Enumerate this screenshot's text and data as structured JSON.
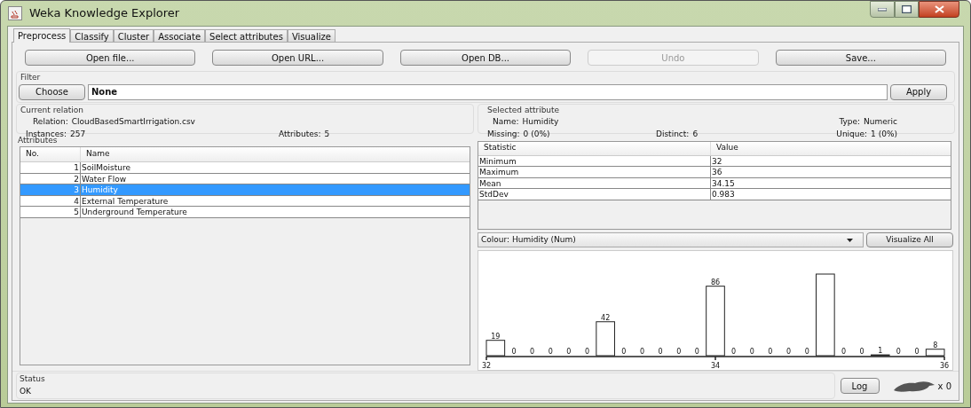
{
  "window": {
    "title": "Weka Knowledge Explorer"
  },
  "tabs": [
    {
      "label": "Preprocess",
      "selected": true
    },
    {
      "label": "Classify",
      "selected": false
    },
    {
      "label": "Cluster",
      "selected": false
    },
    {
      "label": "Associate",
      "selected": false
    },
    {
      "label": "Select attributes",
      "selected": false
    },
    {
      "label": "Visualize",
      "selected": false
    }
  ],
  "toolbar_buttons": [
    {
      "label": "Open file...",
      "disabled": false
    },
    {
      "label": "Open URL...",
      "disabled": false
    },
    {
      "label": "Open DB...",
      "disabled": false
    },
    {
      "label": "Undo",
      "disabled": true
    },
    {
      "label": "Save...",
      "disabled": false
    }
  ],
  "filter": {
    "label": "Filter",
    "choose_button": "Choose",
    "value": "None",
    "apply_button": "Apply"
  },
  "current_relation": {
    "label": "Current relation",
    "relation_label": "Relation:",
    "relation": "CloudBasedSmartIrrigation.csv",
    "instances_label": "Instances:",
    "instances": "257",
    "attributes_label": "Attributes:",
    "attributes": "5"
  },
  "attributes": {
    "label": "Attributes",
    "columns": [
      "No.",
      "Name"
    ],
    "rows": [
      {
        "no": "1",
        "name": "SoilMoisture",
        "selected": false
      },
      {
        "no": "2",
        "name": "Water Flow",
        "selected": false
      },
      {
        "no": "3",
        "name": "Humidity",
        "selected": true
      },
      {
        "no": "4",
        "name": "External Temperature",
        "selected": false
      },
      {
        "no": "5",
        "name": "Underground Temperature",
        "selected": false
      }
    ]
  },
  "selected_attribute": {
    "label": "Selected attribute",
    "name_label": "Name:",
    "name": "Humidity",
    "type_label": "Type:",
    "type": "Numeric",
    "missing_label": "Missing:",
    "missing": "0 (0%)",
    "distinct_label": "Distinct:",
    "distinct": "6",
    "unique_label": "Unique:",
    "unique": "1 (0%)"
  },
  "statistics": {
    "columns": [
      "Statistic",
      "Value"
    ],
    "rows": [
      [
        "Minimum",
        "32"
      ],
      [
        "Maximum",
        "36"
      ],
      [
        "Mean",
        "34.15"
      ],
      [
        "StdDev",
        "0.983"
      ]
    ]
  },
  "colour_dropdown": "Colour: Humidity (Num)",
  "visualize_all_button": "Visualize All",
  "histogram": {
    "chart_data": {
      "type": "bar",
      "xlim": [
        32,
        36
      ],
      "xticks": [
        32,
        34,
        36
      ],
      "x": [
        32.08,
        32.24,
        32.4,
        32.56,
        32.72,
        32.88,
        33.04,
        33.2,
        33.36,
        33.52,
        33.68,
        33.84,
        34,
        34.16,
        34.32,
        34.48,
        34.64,
        34.8,
        34.96,
        35.12,
        35.28,
        35.44,
        35.6,
        35.76,
        35.92
      ],
      "values": [
        19,
        0,
        0,
        0,
        0,
        0,
        42,
        0,
        0,
        0,
        0,
        0,
        86,
        0,
        0,
        0,
        0,
        0,
        101,
        0,
        0,
        1,
        0,
        0,
        8
      ],
      "value_labels": [
        "19",
        "0",
        "0",
        "0",
        "0",
        "0",
        "42",
        "0",
        "0",
        "0",
        "0",
        "0",
        "86",
        "0",
        "0",
        "0",
        "0",
        "0",
        null,
        "0",
        "0",
        "1",
        "0",
        "0",
        "8"
      ]
    }
  },
  "status": {
    "label": "Status",
    "message": "OK",
    "log_button": "Log",
    "count": "x 0"
  }
}
